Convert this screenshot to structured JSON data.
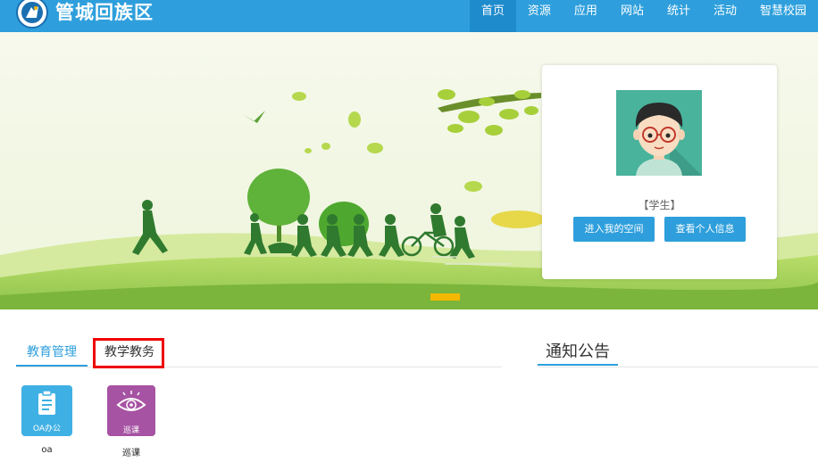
{
  "header": {
    "title": "管城回族区",
    "nav": [
      "首页",
      "资源",
      "应用",
      "网站",
      "统计",
      "活动",
      "智慧校园"
    ],
    "active_index": 0
  },
  "profile": {
    "role": "【学生】",
    "enter_space_label": "进入我的空间",
    "view_info_label": "查看个人信息"
  },
  "tabs": [
    "教育管理",
    "教学教务"
  ],
  "apps": [
    {
      "tile_text": "OA办公",
      "label": "oa",
      "icon": "clipboard-icon",
      "color": "#3fb0e4"
    },
    {
      "tile_text": "巡课",
      "label": "巡课",
      "icon": "eye-icon",
      "color": "#a653a3"
    }
  ],
  "notice": {
    "title": "通知公告"
  },
  "colors": {
    "primary": "#2e9fdc",
    "highlight": "#ee0000",
    "banner_indicator": "#f4b800"
  }
}
